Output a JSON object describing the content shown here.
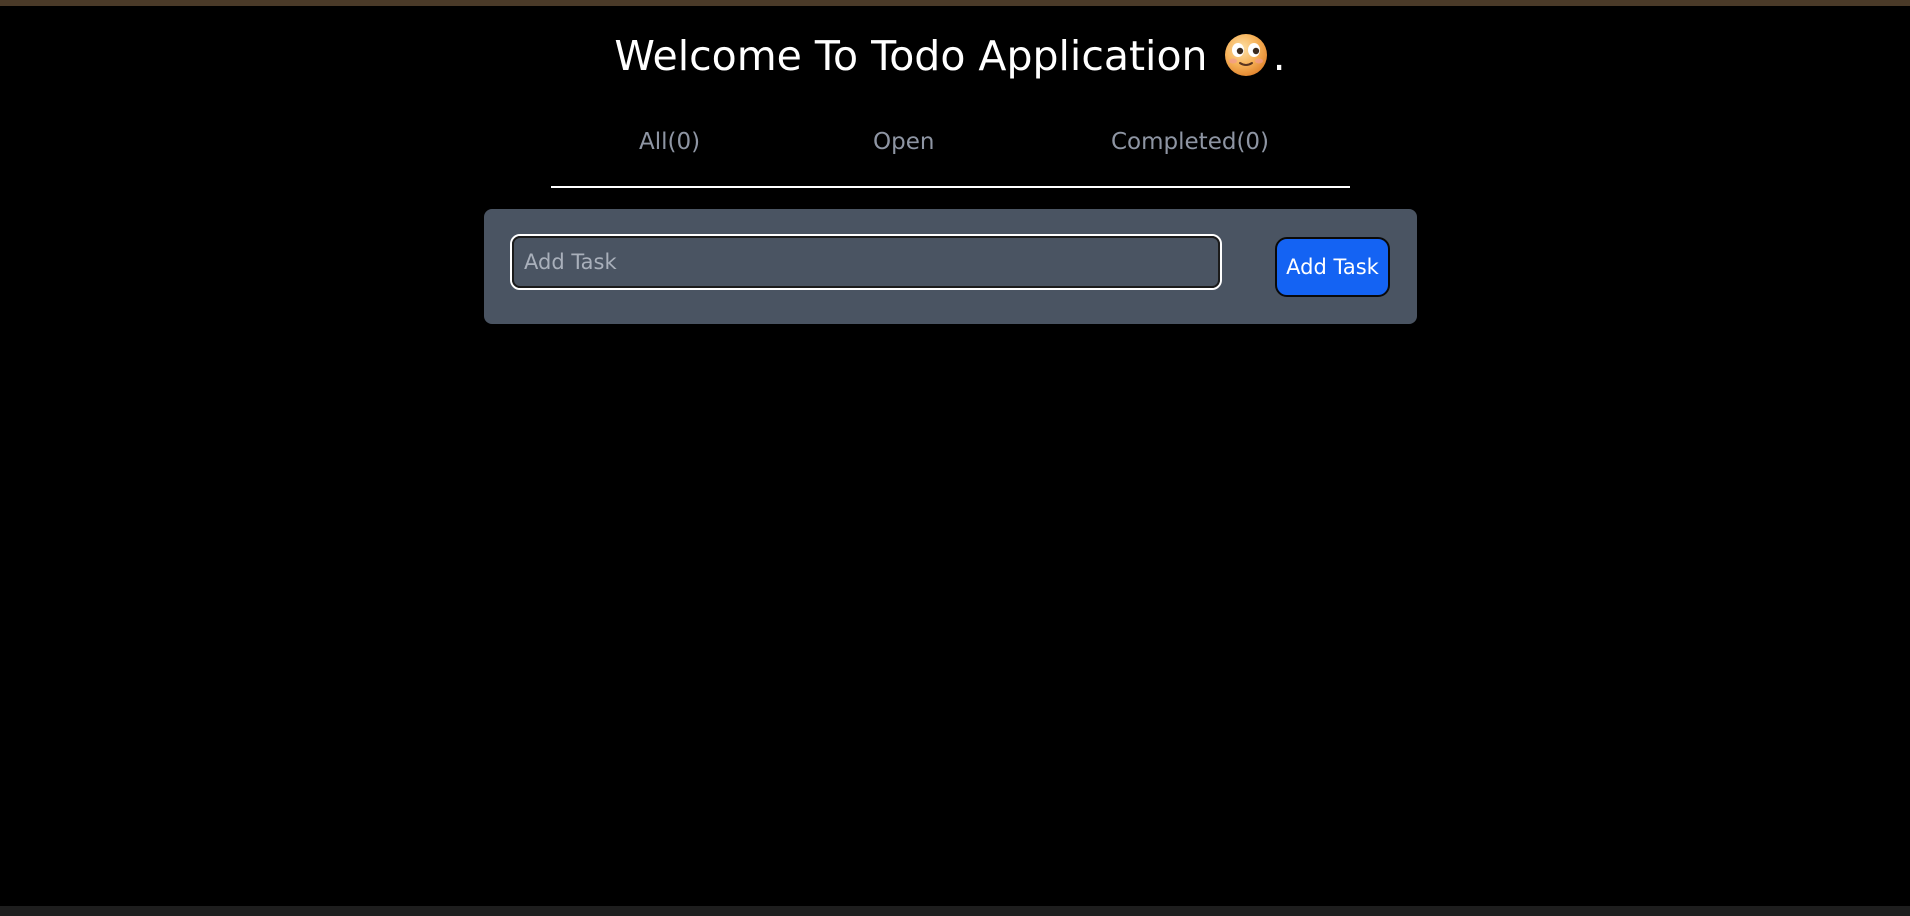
{
  "header": {
    "title": "Welcome To Todo Application",
    "emoji_icon": "smiling-face-icon",
    "title_suffix": "."
  },
  "tabs": [
    {
      "label": "All(0)"
    },
    {
      "label": "Open"
    },
    {
      "label": "Completed(0)"
    }
  ],
  "add_task": {
    "input_value": "",
    "input_placeholder": "Add Task",
    "button_label": "Add Task"
  },
  "colors": {
    "background": "#000000",
    "panel": "#4a5462",
    "accent_button": "#1463f3",
    "tab_text": "#8e95a3",
    "title_text": "#ffffff"
  }
}
